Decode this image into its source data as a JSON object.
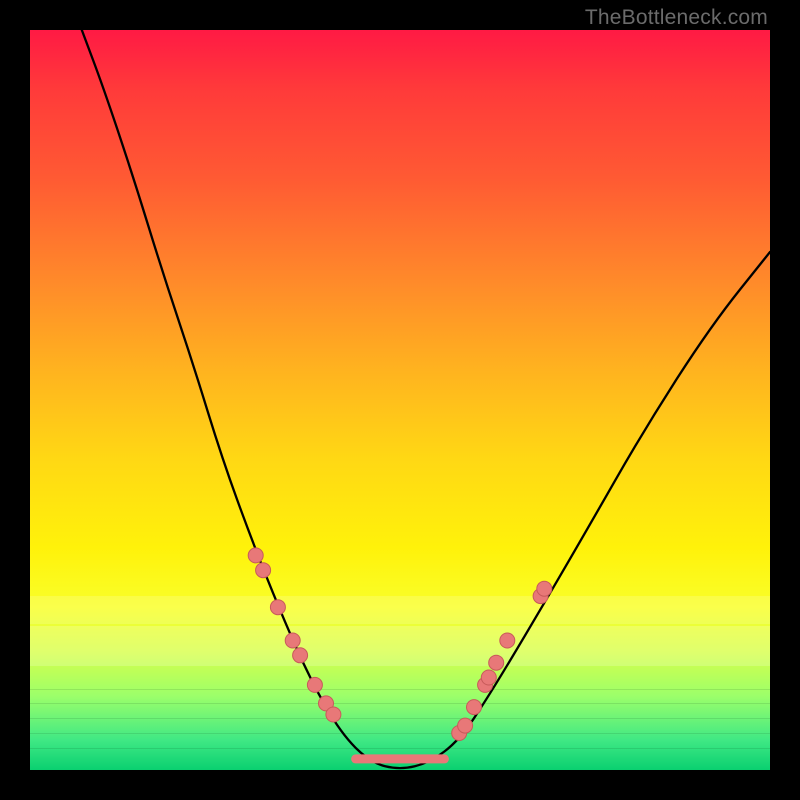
{
  "attribution": "TheBottleneck.com",
  "colors": {
    "marker_fill": "#e87878",
    "marker_stroke": "#c85a5a",
    "curve_stroke": "#000000"
  },
  "chart_data": {
    "type": "line",
    "title": "",
    "xlabel": "",
    "ylabel": "",
    "xlim": [
      0,
      100
    ],
    "ylim": [
      0,
      100
    ],
    "curve": [
      {
        "x": 7,
        "y": 100
      },
      {
        "x": 10,
        "y": 92
      },
      {
        "x": 14,
        "y": 80
      },
      {
        "x": 18,
        "y": 67
      },
      {
        "x": 22,
        "y": 55
      },
      {
        "x": 26,
        "y": 42
      },
      {
        "x": 30,
        "y": 31
      },
      {
        "x": 34,
        "y": 21
      },
      {
        "x": 38,
        "y": 12
      },
      {
        "x": 42,
        "y": 5
      },
      {
        "x": 46,
        "y": 1
      },
      {
        "x": 50,
        "y": 0
      },
      {
        "x": 54,
        "y": 1
      },
      {
        "x": 58,
        "y": 4
      },
      {
        "x": 62,
        "y": 10
      },
      {
        "x": 68,
        "y": 20
      },
      {
        "x": 75,
        "y": 32
      },
      {
        "x": 83,
        "y": 46
      },
      {
        "x": 92,
        "y": 60
      },
      {
        "x": 100,
        "y": 70
      }
    ],
    "markers": [
      {
        "x": 30.5,
        "y": 29.0
      },
      {
        "x": 31.5,
        "y": 27.0
      },
      {
        "x": 33.5,
        "y": 22.0
      },
      {
        "x": 35.5,
        "y": 17.5
      },
      {
        "x": 36.5,
        "y": 15.5
      },
      {
        "x": 38.5,
        "y": 11.5
      },
      {
        "x": 40.0,
        "y": 9.0
      },
      {
        "x": 41.0,
        "y": 7.5
      },
      {
        "x": 58.0,
        "y": 5.0
      },
      {
        "x": 58.8,
        "y": 6.0
      },
      {
        "x": 60.0,
        "y": 8.5
      },
      {
        "x": 61.5,
        "y": 11.5
      },
      {
        "x": 62.0,
        "y": 12.5
      },
      {
        "x": 63.0,
        "y": 14.5
      },
      {
        "x": 64.5,
        "y": 17.5
      },
      {
        "x": 69.0,
        "y": 23.5
      },
      {
        "x": 69.5,
        "y": 24.5
      }
    ],
    "valley_segment": {
      "x1": 44,
      "x2": 56,
      "y": 1.5
    }
  }
}
